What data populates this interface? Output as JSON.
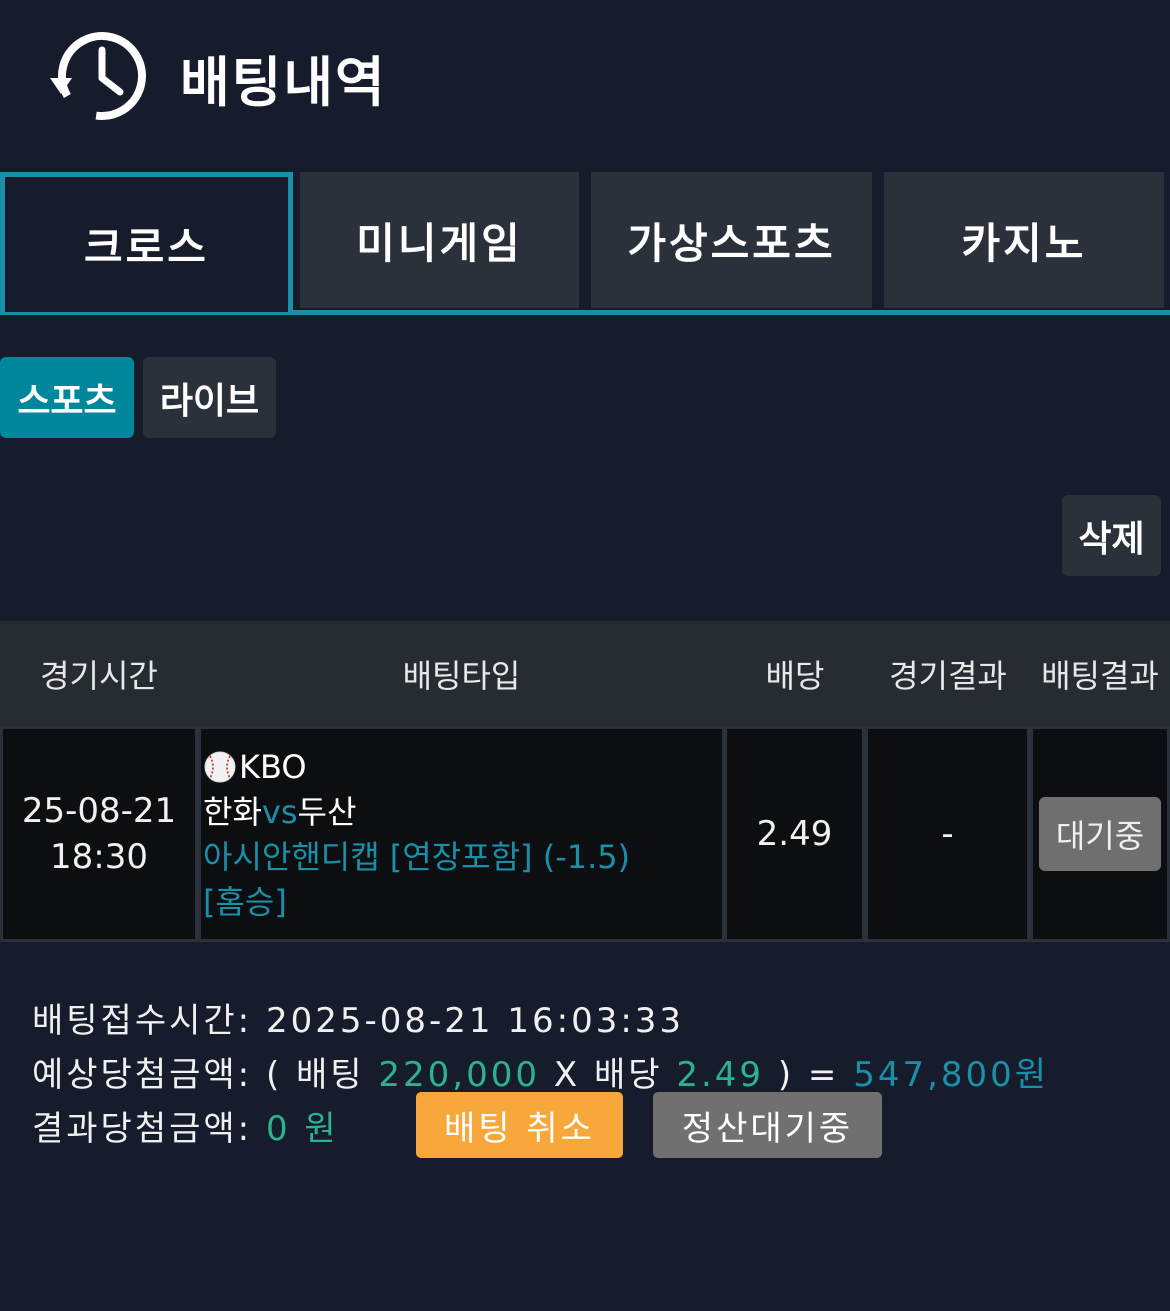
{
  "header": {
    "title": "배팅내역",
    "icon": "history-clock-icon"
  },
  "tabs": [
    {
      "label": "크로스",
      "active": true
    },
    {
      "label": "미니게임",
      "active": false
    },
    {
      "label": "가상스포츠",
      "active": false
    },
    {
      "label": "카지노",
      "active": false
    }
  ],
  "subtabs": [
    {
      "label": "스포츠",
      "active": true
    },
    {
      "label": "라이브",
      "active": false
    }
  ],
  "delete_label": "삭제",
  "table": {
    "headers": [
      "경기시간",
      "배팅타입",
      "배당",
      "경기결과",
      "배팅결과"
    ],
    "row": {
      "date": "25-08-21",
      "time": "18:30",
      "league_icon": "baseball-icon",
      "league": "KBO",
      "home": "한화",
      "vs": "vs",
      "away": "두산",
      "market": "아시안핸디캡 [연장포함] (-1.5)",
      "pick": "[홈승]",
      "odds": "2.49",
      "game_result": "-",
      "bet_result": "대기중"
    }
  },
  "summary": {
    "accept_label": "배팅접수시간:",
    "accept_time": "2025-08-21 16:03:33",
    "expected_label": "예상당첨금액:",
    "open_paren": "(",
    "bet_label": "배팅",
    "bet_amount": "220,000",
    "x": "X",
    "odds_label": "배당",
    "odds": "2.49",
    "close_eq": ") =",
    "expected_amount": "547,800원",
    "result_label": "결과당첨금액:",
    "result_amount": "0 원"
  },
  "buttons": {
    "cancel": "배팅 취소",
    "settle": "정산대기중"
  },
  "colors": {
    "background": "#161c2c",
    "accent": "#1a8fa8",
    "green": "#2bb38f",
    "orange": "#f8a83a",
    "gray_button": "#707070"
  }
}
